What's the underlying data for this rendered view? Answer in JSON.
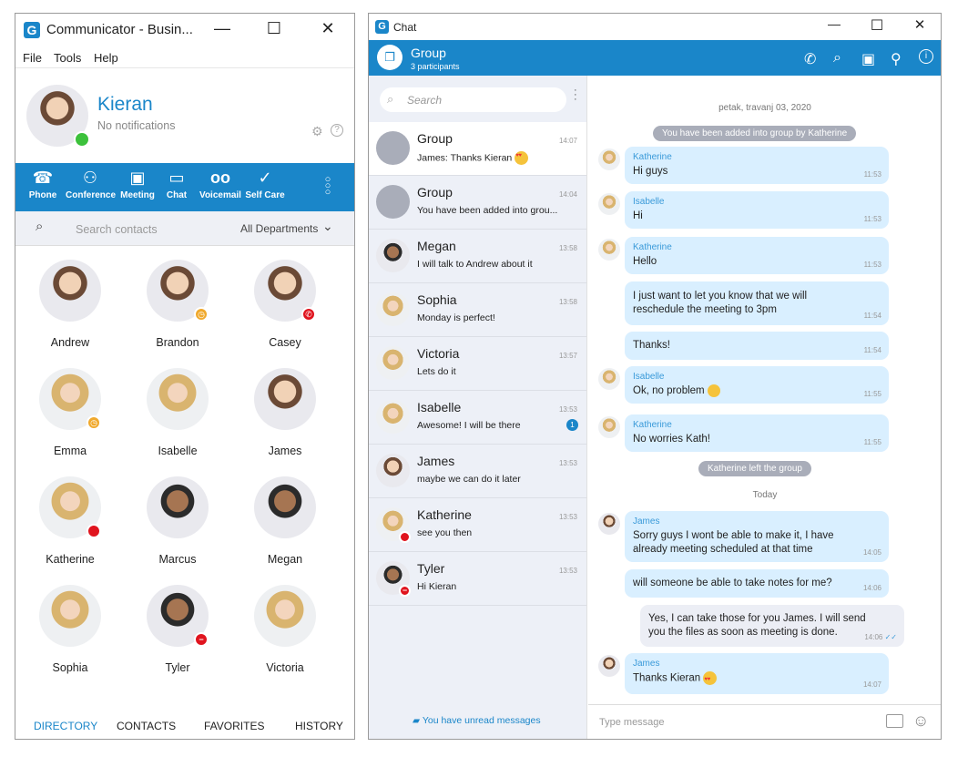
{
  "communicator": {
    "title": "Communicator - Busin...",
    "menu": [
      "File",
      "Tools",
      "Help"
    ],
    "profile": {
      "name": "Kieran",
      "status": "No notifications",
      "presence_color": "#3cc13b"
    },
    "toolbar": [
      {
        "label": "Phone",
        "icon": "phone-icon"
      },
      {
        "label": "Conference",
        "icon": "conference-icon"
      },
      {
        "label": "Meeting",
        "icon": "meeting-icon"
      },
      {
        "label": "Chat",
        "icon": "chat-icon"
      },
      {
        "label": "Voicemail",
        "icon": "voicemail-icon"
      },
      {
        "label": "Self Care",
        "icon": "self-care-icon"
      }
    ],
    "search": {
      "placeholder": "Search contacts",
      "department": "All Departments"
    },
    "contacts": [
      {
        "name": "Andrew",
        "status": ""
      },
      {
        "name": "Brandon",
        "status": "away"
      },
      {
        "name": "Casey",
        "status": "on-call"
      },
      {
        "name": "Emma",
        "status": "away"
      },
      {
        "name": "Isabelle",
        "status": ""
      },
      {
        "name": "James",
        "status": ""
      },
      {
        "name": "Katherine",
        "status": "busy"
      },
      {
        "name": "Marcus",
        "status": ""
      },
      {
        "name": "Megan",
        "status": ""
      },
      {
        "name": "Sophia",
        "status": ""
      },
      {
        "name": "Tyler",
        "status": "do-not-disturb"
      },
      {
        "name": "Victoria",
        "status": ""
      }
    ],
    "tabs": [
      "DIRECTORY",
      "CONTACTS",
      "FAVORITES",
      "HISTORY"
    ],
    "active_tab": "DIRECTORY",
    "accent": "#1a86c9"
  },
  "chat": {
    "title": "Chat",
    "header": {
      "name": "Group",
      "sub": "3 participants"
    },
    "search_placeholder": "Search",
    "list": [
      {
        "name": "Group",
        "preview": "James: Thanks Kieran",
        "time": "14:07",
        "emoji": true
      },
      {
        "name": "Group",
        "preview": "You have been added into grou...",
        "time": "14:04"
      },
      {
        "name": "Megan",
        "preview": "I will talk to Andrew about it",
        "time": "13:58"
      },
      {
        "name": "Sophia",
        "preview": "Monday is perfect!",
        "time": "13:58"
      },
      {
        "name": "Victoria",
        "preview": "Lets do it",
        "time": "13:57"
      },
      {
        "name": "Isabelle",
        "preview": "Awesome! I will be there",
        "time": "13:53",
        "unread": "1"
      },
      {
        "name": "James",
        "preview": "maybe we can do it later",
        "time": "13:53"
      },
      {
        "name": "Katherine",
        "preview": "see you then",
        "time": "13:53"
      },
      {
        "name": "Tyler",
        "preview": "Hi Kieran",
        "time": "13:53"
      }
    ],
    "unread_notice": "You have unread messages",
    "date1": "petak, travanj 03, 2020",
    "sys1": "You have been added into group by Katherine",
    "messages": [
      {
        "sender": "Katherine",
        "text": "Hi guys",
        "time": "11:53"
      },
      {
        "sender": "Isabelle",
        "text": "Hi",
        "time": "11:53"
      },
      {
        "sender": "Katherine",
        "text": "Hello",
        "time": "11:53"
      },
      {
        "sender": "",
        "text": "I just want to let you know that we will reschedule the meeting to 3pm",
        "time": "11:54"
      },
      {
        "sender": "",
        "text": "Thanks!",
        "time": "11:54"
      },
      {
        "sender": "Isabelle",
        "text": "Ok, no problem",
        "time": "11:55"
      },
      {
        "sender": "Katherine",
        "text": "No worries Kath!",
        "time": "11:55"
      },
      {
        "sender": "James",
        "text": "Sorry guys I wont be able to make it, I have already meeting scheduled at that time",
        "time": "14:05"
      },
      {
        "sender": "",
        "text": "will someone be able to take notes for me?",
        "time": "14:06"
      },
      {
        "sender": "",
        "text": "Yes, I can take those for you James. I will send you the files as soon as meeting is done.",
        "time": "14:06"
      },
      {
        "sender": "James",
        "text": "Thanks Kieran",
        "time": "14:07"
      }
    ],
    "sys2": "Katherine left the group",
    "date2": "Today",
    "input_placeholder": "Type message"
  }
}
